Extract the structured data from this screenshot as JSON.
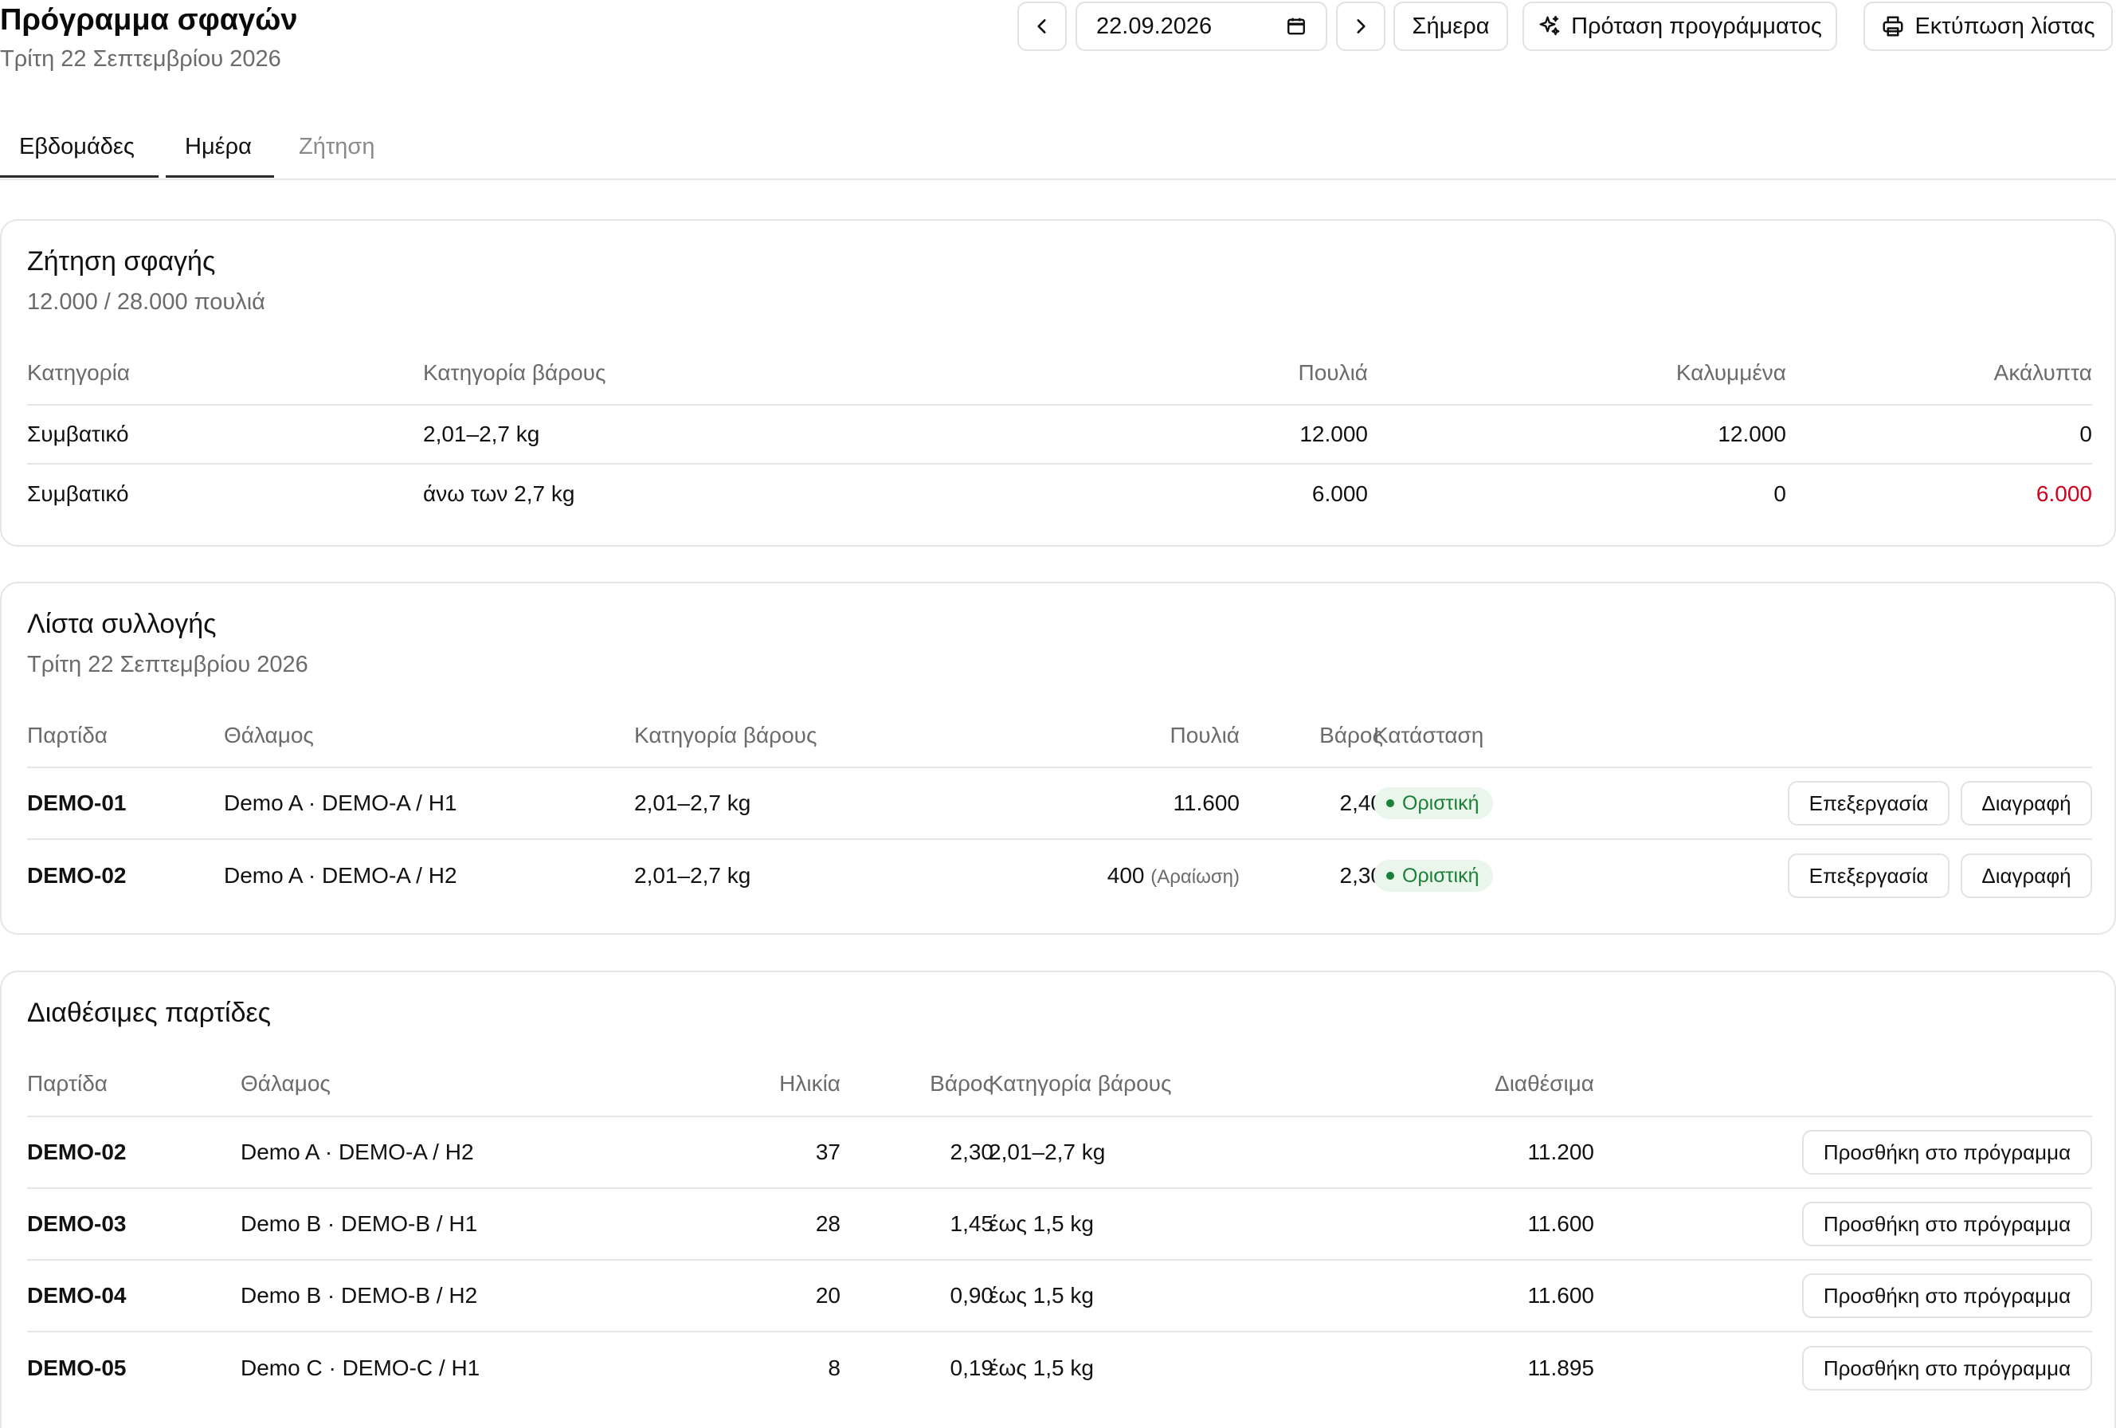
{
  "header": {
    "title": "Πρόγραμμα σφαγών",
    "subtitle": "Τρίτη 22 Σεπτεμβρίου 2026",
    "date_value": "22.09.2026",
    "today_label": "Σήμερα",
    "suggest_label": "Πρόταση προγράμματος",
    "print_label": "Εκτύπωση λίστας"
  },
  "tabs": [
    {
      "label": "Εβδομάδες"
    },
    {
      "label": "Ημέρα"
    },
    {
      "label": "Ζήτηση"
    }
  ],
  "demand": {
    "title": "Ζήτηση σφαγής",
    "summary": "12.000 / 28.000 πουλιά",
    "columns": [
      "Κατηγορία",
      "Κατηγορία βάρους",
      "Πουλιά",
      "Καλυμμένα",
      "Ακάλυπτα"
    ],
    "rows": [
      {
        "category": "Συμβατικό",
        "weight_class": "2,01–2,7 kg",
        "birds": "12.000",
        "covered": "12.000",
        "uncovered": "0"
      },
      {
        "category": "Συμβατικό",
        "weight_class": "άνω των 2,7 kg",
        "birds": "6.000",
        "covered": "0",
        "uncovered": "6.000"
      }
    ]
  },
  "pick_list": {
    "title": "Λίστα συλλογής",
    "subtitle": "Τρίτη 22 Σεπτεμβρίου 2026",
    "columns": [
      "Παρτίδα",
      "Θάλαμος",
      "Κατηγορία βάρους",
      "Πουλιά",
      "Βάρος",
      "Κατάσταση"
    ],
    "edit_label": "Επεξεργασία",
    "delete_label": "Διαγραφή",
    "rows": [
      {
        "batch": "DEMO-01",
        "house": "Demo A · DEMO-A / H1",
        "weight_class": "2,01–2,7 kg",
        "birds": "11.600",
        "note": "",
        "weight": "2,40",
        "status": "Οριστική"
      },
      {
        "batch": "DEMO-02",
        "house": "Demo A · DEMO-A / H2",
        "weight_class": "2,01–2,7 kg",
        "birds": "400",
        "note": "(Αραίωση)",
        "weight": "2,30",
        "status": "Οριστική"
      }
    ]
  },
  "available": {
    "title": "Διαθέσιμες παρτίδες",
    "columns": [
      "Παρτίδα",
      "Θάλαμος",
      "Ηλικία",
      "Βάρος",
      "Κατηγορία βάρους",
      "Διαθέσιμα"
    ],
    "add_label": "Προσθήκη στο πρόγραμμα",
    "rows": [
      {
        "batch": "DEMO-02",
        "house": "Demo A · DEMO-A / H2",
        "age": "37",
        "weight": "2,30",
        "weight_class": "2,01–2,7 kg",
        "available": "11.200"
      },
      {
        "batch": "DEMO-03",
        "house": "Demo B · DEMO-B / H1",
        "age": "28",
        "weight": "1,45",
        "weight_class": "έως 1,5 kg",
        "available": "11.600"
      },
      {
        "batch": "DEMO-04",
        "house": "Demo B · DEMO-B / H2",
        "age": "20",
        "weight": "0,90",
        "weight_class": "έως 1,5 kg",
        "available": "11.600"
      },
      {
        "batch": "DEMO-05",
        "house": "Demo C · DEMO-C / H1",
        "age": "8",
        "weight": "0,19",
        "weight_class": "έως 1,5 kg",
        "available": "11.895"
      }
    ]
  },
  "colors": {
    "accent_text": "#111111",
    "muted_text": "#6b6b6b",
    "danger": "#d0021b",
    "status_green": "#1a7f37",
    "status_bg": "#eaf6ec",
    "border": "#e6e6e6"
  }
}
